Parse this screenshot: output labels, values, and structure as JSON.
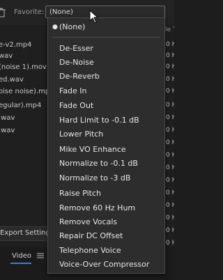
{
  "header": {
    "favorite_label": "Favorite:",
    "favorite_value": "(None)"
  },
  "file_list": {
    "items": [
      "e-v2.mp4",
      "wav",
      "(noise 1).mov",
      "ed.wav",
      "oise noise).mp",
      "egular).mp4",
      ".wav",
      ".wav"
    ]
  },
  "right_column": {
    "header": "le T",
    "cells": [
      "0 H",
      "0 H",
      "0 H",
      "0 H",
      "0 H",
      "0 H",
      "0 H",
      "0 H",
      "0 H",
      "0 H",
      "0 H",
      "0 H",
      "0 H",
      "0 H",
      "0 H",
      "0 H",
      "0 H"
    ]
  },
  "dropdown": {
    "selected": "(None)",
    "items": [
      "De-Esser",
      "De-Noise",
      "De-Reverb",
      "Fade In",
      "Fade Out",
      "Hard Limit to -0.1 dB",
      "Lower Pitch",
      "Mike VO Enhance",
      "Normalize to -0.1 dB",
      "Normalize to -3 dB",
      "Raise Pitch",
      "Remove 60 Hz Hum",
      "Remove Vocals",
      "Repair DC Offset",
      "Telephone Voice",
      "Voice-Over Compressor"
    ]
  },
  "bottom": {
    "export_label": "Export Setting",
    "video_tab": "Video"
  },
  "colors": {
    "menu_bg": "#2d2d2d",
    "accent": "#3c7ad6"
  },
  "icons": [
    "trash-icon",
    "cursor-icon",
    "menu-lines-icon",
    "bullet-icon"
  ]
}
